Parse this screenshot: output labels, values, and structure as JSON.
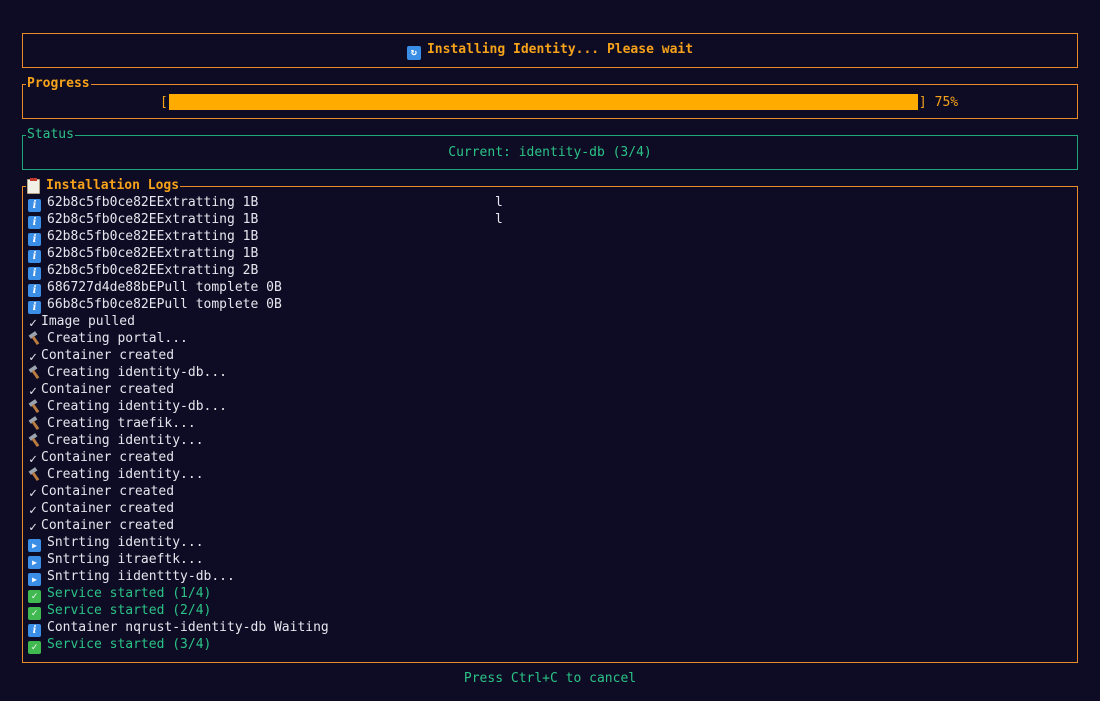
{
  "header": {
    "icon": "refresh-icon",
    "title": "Installing Identity... Please wait"
  },
  "progress": {
    "legend": "Progress",
    "bracket_open": "[",
    "bracket_close": "]",
    "fraction": 1.0,
    "percent_label": "75%"
  },
  "status": {
    "legend": "Status",
    "text": "Current: identity-db (3/4)"
  },
  "logs": {
    "legend": "Installation Logs",
    "lines": [
      {
        "type": "info",
        "text": "62b8c5fb0ce82EExtratting 1B",
        "stray": "l"
      },
      {
        "type": "info",
        "text": "62b8c5fb0ce82EExtratting 1B",
        "stray": "l"
      },
      {
        "type": "info",
        "text": "62b8c5fb0ce82EExtratting 1B"
      },
      {
        "type": "info",
        "text": "62b8c5fb0ce82EExtratting 1B"
      },
      {
        "type": "info",
        "text": "62b8c5fb0ce82EExtratting 2B"
      },
      {
        "type": "info",
        "text": "686727d4de88bEPull tomplete 0B"
      },
      {
        "type": "info",
        "text": "66b8c5fb0ce82EPull tomplete 0B"
      },
      {
        "type": "check",
        "text": "Image pulled"
      },
      {
        "type": "hammer",
        "text": "Creating portal..."
      },
      {
        "type": "check",
        "text": "Container created"
      },
      {
        "type": "hammer",
        "text": "Creating identity-db..."
      },
      {
        "type": "check",
        "text": "Container created"
      },
      {
        "type": "hammer",
        "text": "Creating identity-db..."
      },
      {
        "type": "hammer",
        "text": "Creating traefik..."
      },
      {
        "type": "hammer",
        "text": "Creating identity..."
      },
      {
        "type": "check",
        "text": "Container created"
      },
      {
        "type": "hammer",
        "text": "Creating identity..."
      },
      {
        "type": "check",
        "text": "Container created"
      },
      {
        "type": "check",
        "text": "Container created"
      },
      {
        "type": "check",
        "text": "Container created"
      },
      {
        "type": "play",
        "text": "Sntrting identity..."
      },
      {
        "type": "play",
        "text": "Sntrting itraeftk..."
      },
      {
        "type": "play",
        "text": "Sntrting iidenttty-db..."
      },
      {
        "type": "done",
        "text": "Service started (1/4)"
      },
      {
        "type": "done",
        "text": "Service started (2/4)"
      },
      {
        "type": "info",
        "text": "Container nqrust-identity-db Waiting"
      },
      {
        "type": "done",
        "text": "Service started (3/4)"
      }
    ]
  },
  "footer": {
    "hint": "Press Ctrl+C to cancel"
  },
  "colors": {
    "background": "#0e0b24",
    "accent": "#f6a21a",
    "progress_fill": "#ffab00",
    "success": "#2bc386"
  }
}
